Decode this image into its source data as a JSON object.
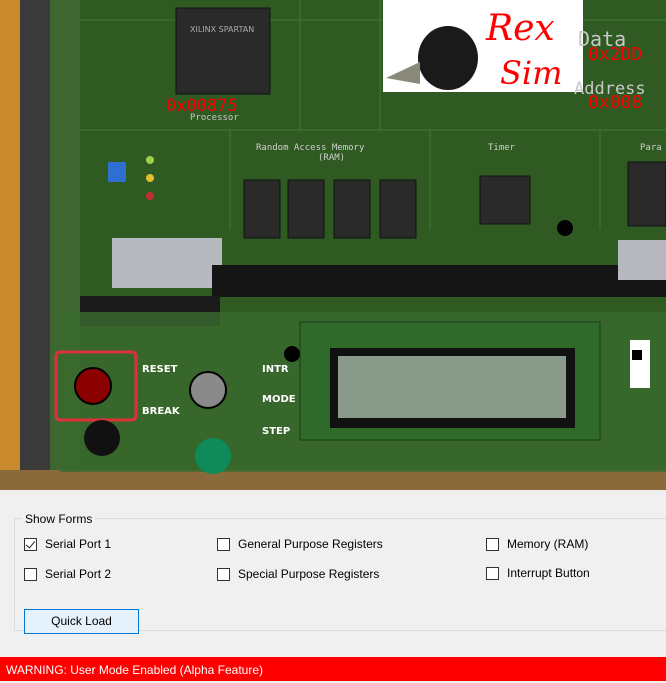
{
  "board": {
    "logo_rex": "Rex",
    "logo_sim": "Sim",
    "data_label": "Data",
    "data_value": "0x2DD",
    "address_label": "Address",
    "address_value": "0x008",
    "processor_value": "0x00875",
    "processor_label": "Processor",
    "chip_label": "XILINX SPARTAN",
    "ram_label": "Random Access Memory",
    "ram_sub": "(RAM)",
    "timer_label": "Timer",
    "para_label": "Para",
    "reset_label": "RESET",
    "break_label": "BREAK",
    "intr_label": "INTR",
    "mode_label": "MODE",
    "step_label": "STEP"
  },
  "forms": {
    "group_title": "Show Forms",
    "checkboxes": [
      {
        "label": "Serial Port 1",
        "checked": true
      },
      {
        "label": "Serial Port 2",
        "checked": false
      },
      {
        "label": "General Purpose Registers",
        "checked": false
      },
      {
        "label": "Special Purpose Registers",
        "checked": false
      },
      {
        "label": "Memory (RAM)",
        "checked": false
      },
      {
        "label": "Interrupt Button",
        "checked": false
      }
    ]
  },
  "quick_load_label": "Quick Load",
  "warning_text": "WARNING: User Mode Enabled (Alpha Feature)",
  "colors": {
    "warning_bg": "#ff0000",
    "overlay_red": "#ff0000",
    "board_green": "#2f5a22"
  }
}
